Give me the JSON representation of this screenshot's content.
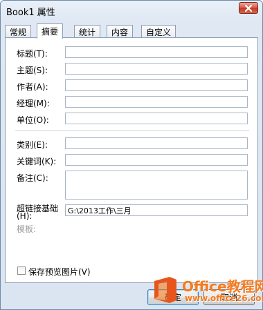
{
  "window": {
    "title": "Book1 属性"
  },
  "tabs": [
    {
      "label": "常规"
    },
    {
      "label": "摘要"
    },
    {
      "label": "统计"
    },
    {
      "label": "内容"
    },
    {
      "label": "自定义"
    }
  ],
  "active_tab": "摘要",
  "fields": {
    "title": {
      "label": "标题(T):",
      "value": ""
    },
    "subject": {
      "label": "主题(S):",
      "value": ""
    },
    "author": {
      "label": "作者(A):",
      "value": ""
    },
    "manager": {
      "label": "经理(M):",
      "value": ""
    },
    "company": {
      "label": "单位(O):",
      "value": ""
    },
    "category": {
      "label": "类别(E):",
      "value": ""
    },
    "keywords": {
      "label": "关键词(K):",
      "value": ""
    },
    "comments": {
      "label": "备注(C):",
      "value": ""
    },
    "hyperlink_base": {
      "label_line1": "超链接基础",
      "label_line2": "(H):",
      "value": "G:\\2013工作\\三月"
    },
    "template": {
      "label": "模板:"
    }
  },
  "save_preview": {
    "label": "保存预览图片(V)",
    "checked": false
  },
  "buttons": {
    "ok": "确定",
    "cancel": "取消"
  },
  "watermark": {
    "title": "Office教程网",
    "url": "www.office26.com"
  },
  "colors": {
    "accent_orange": "#f47b20",
    "close_red": "#c0391f"
  }
}
